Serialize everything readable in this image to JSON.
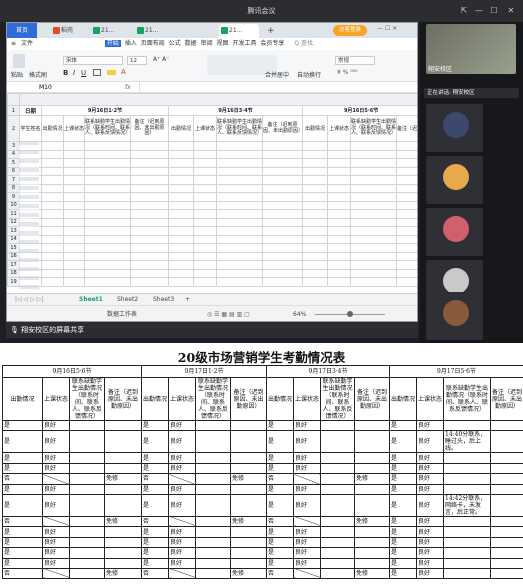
{
  "window": {
    "title": "腾讯会议"
  },
  "tabs": [
    {
      "label": "首页"
    },
    {
      "label": "稻壳",
      "color": "#e24b2c"
    },
    {
      "label": "21...",
      "color": "#1aa260"
    },
    {
      "label": "21...",
      "color": "#1aa260"
    },
    {
      "label": "21...",
      "color": "#1aa260"
    }
  ],
  "new_tab": "+",
  "login_button": "访客登录",
  "menu": {
    "file": "文件",
    "items": [
      "开始",
      "插入",
      "页面布局",
      "公式",
      "数据",
      "审阅",
      "视图",
      "开发工具",
      "会员专享"
    ],
    "search": "Q 查找"
  },
  "ribbon": {
    "paste": "粘贴",
    "format_painter": "格式刷",
    "font": "宋体",
    "size": "12",
    "merge": "合并居中",
    "wrap": "自动换行",
    "number_format": "常规"
  },
  "formula_bar": {
    "cell": "M10",
    "fx": "fx"
  },
  "sheet": {
    "date_label": "日期",
    "groups": [
      "9月16日1·2节",
      "9月16日3·4节",
      "9月16日5·6节"
    ],
    "name_col": "学生姓名",
    "sub_cols": [
      "出勤情况",
      "上课状态",
      "联系缺勤学生出勤情况（联系时间、联系人、联系反馈情况）",
      "备注（迟到原因、未出勤原因）"
    ],
    "row_numbers": [
      "3",
      "4",
      "5",
      "6",
      "7",
      "8",
      "9",
      "10",
      "11",
      "12",
      "13",
      "14",
      "15",
      "16",
      "17",
      "18",
      "19"
    ]
  },
  "sheet_tabs": [
    "Sheet1",
    "Sheet2",
    "Sheet3"
  ],
  "status": {
    "doc": "数据工作表",
    "zoom": "64%"
  },
  "sharing_bar": {
    "text": "翔安校区的屏幕共享"
  },
  "sidebar": {
    "top_name": "翔安校区",
    "speaking": "正在讲话: 翔安校区"
  },
  "paper": {
    "title": "20级市场营销学生考勤情况表",
    "groups": [
      "9月16日5·6节",
      "9月17日1·2节",
      "9月17日3·4节",
      "9月17日5·6节"
    ],
    "cols": {
      "attend": "出勤情况",
      "state": "上课状态",
      "contact": "联系缺勤学生出勤情况（联系时间、联系人、联系反馈情况）",
      "contact_wide": "联系缺勤学生出勤情况（联系时间、联系人、联系反馈情况）",
      "note": "备注（迟到原因、未出勤原因）"
    },
    "rows": [
      {
        "a1": "是",
        "s1": "良好",
        "a2": "是",
        "s2": "良好",
        "a3": "是",
        "s3": "良好",
        "a4": "是",
        "s4": "良好"
      },
      {
        "a1": "是",
        "s1": "良好",
        "a2": "是",
        "s2": "良好",
        "a3": "是",
        "s3": "良好",
        "a4": "是",
        "s4": "良好",
        "c4": "14:40分联系，睡过头，后上线。"
      },
      {
        "a1": "是",
        "s1": "良好",
        "a2": "是",
        "s2": "良好",
        "a3": "是",
        "s3": "良好",
        "a4": "是",
        "s4": "良好"
      },
      {
        "a1": "是",
        "s1": "良好",
        "a2": "是",
        "s2": "良好",
        "a3": "是",
        "s3": "良好",
        "a4": "是",
        "s4": "良好"
      },
      {
        "a1": "否",
        "d1": true,
        "n1": "免修",
        "a2": "否",
        "d2": true,
        "n2": "免修",
        "a3": "否",
        "d3": true,
        "n3": "免修",
        "a4": "是",
        "s4": "良好"
      },
      {
        "a1": "是",
        "s1": "良好",
        "a2": "是",
        "s2": "良好",
        "a3": "是",
        "s3": "良好",
        "a4": "是",
        "s4": "良好"
      },
      {
        "a1": "是",
        "s1": "良好",
        "a2": "是",
        "s2": "良好",
        "a3": "是",
        "s3": "良好",
        "a4": "是",
        "s4": "良好",
        "c4": "14:42分联系，网络卡，未发言，后正常。"
      },
      {
        "a1": "否",
        "d1": true,
        "n1": "免修",
        "a2": "否",
        "d2": true,
        "n2": "免修",
        "a3": "否",
        "d3": true,
        "n3": "免修",
        "a4": "是",
        "s4": "良好"
      },
      {
        "a1": "是",
        "s1": "良好",
        "a2": "是",
        "s2": "良好",
        "a3": "是",
        "s3": "良好",
        "a4": "是",
        "s4": "良好"
      },
      {
        "a1": "是",
        "s1": "良好",
        "a2": "是",
        "s2": "良好",
        "a3": "是",
        "s3": "良好",
        "a4": "是",
        "s4": "良好"
      },
      {
        "a1": "是",
        "s1": "良好",
        "a2": "是",
        "s2": "良好",
        "a3": "是",
        "s3": "良好",
        "a4": "是",
        "s4": "良好"
      },
      {
        "a1": "是",
        "s1": "良好",
        "a2": "是",
        "s2": "良好",
        "a3": "是",
        "s3": "良好",
        "a4": "是",
        "s4": "良好"
      },
      {
        "a1": "否",
        "d1": true,
        "n1": "免修",
        "a2": "否",
        "d2": true,
        "n2": "免修",
        "a3": "否",
        "d3": true,
        "n3": "免修",
        "a4": "是",
        "s4": "良好"
      }
    ]
  }
}
